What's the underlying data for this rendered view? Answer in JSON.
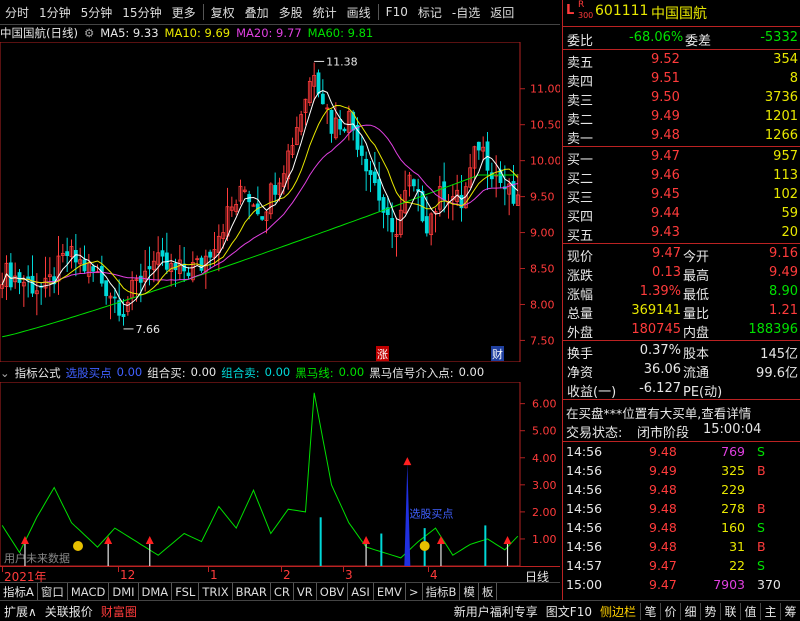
{
  "toolbar": {
    "items": [
      "分时",
      "1分钟",
      "5分钟",
      "15分钟",
      "更多",
      "复权",
      "叠加",
      "多股",
      "统计",
      "画线",
      "F10",
      "标记",
      "-自选",
      "返回"
    ]
  },
  "chart": {
    "title": "中国国航(日线)",
    "ma5": "MA5: 9.33",
    "ma10": "MA10: 9.69",
    "ma20": "MA20: 9.77",
    "ma60": "MA60: 9.81",
    "high_label": "11.38",
    "low_label": "7.66",
    "price_ticks": [
      "11.00",
      "10.50",
      "10.00",
      "9.50",
      "9.00",
      "8.50",
      "8.00",
      "7.50"
    ],
    "badge_up": "涨",
    "badge_fin": "财"
  },
  "indicator": {
    "name": "指标公式",
    "labels": [
      {
        "text": "选股买点",
        "color": "#4060ff"
      },
      {
        "text": "0.00",
        "color": "#4060ff"
      },
      {
        "text": "组合买:",
        "color": "#e6e6e6"
      },
      {
        "text": "0.00",
        "color": "#e6e6e6"
      },
      {
        "text": "组合卖:",
        "color": "#00d8d8"
      },
      {
        "text": "0.00",
        "color": "#00d8d8"
      },
      {
        "text": "黑马线:",
        "color": "#00e000"
      },
      {
        "text": "0.00",
        "color": "#00e000"
      },
      {
        "text": "黑马信号介入点:",
        "color": "#e6e6e6"
      },
      {
        "text": "0.00",
        "color": "#e6e6e6"
      }
    ],
    "ticks": [
      "6.00",
      "5.00",
      "4.00",
      "3.00",
      "2.00",
      "1.00"
    ],
    "annotation": "选股买点",
    "watermark": "用户未来数据"
  },
  "dates": [
    "2021年",
    "12",
    "1",
    "2",
    "3",
    "4"
  ],
  "axis_label": "日线",
  "tabs": [
    "指标A",
    "窗口",
    "MACD",
    "DMI",
    "DMA",
    "FSL",
    "TRIX",
    "BRAR",
    "CR",
    "VR",
    "OBV",
    "ASI",
    "EMV",
    ">",
    "指标B",
    "模",
    "板"
  ],
  "bottom": {
    "left": [
      "扩展∧",
      "关联报价",
      "财富圈"
    ],
    "middle": [
      "新用户福利专享",
      "图文F10",
      "侧边栏"
    ],
    "right": [
      "笔",
      "价",
      "细",
      "势",
      "联",
      "值",
      "主",
      "筹"
    ]
  },
  "stock": {
    "code": "601111",
    "name": "中国国航",
    "badge_l": "L",
    "badge_r": "R",
    "badge_n": "300"
  },
  "orderbook": {
    "webi_label": "委比",
    "webi_value": "-68.06%",
    "weicha_label": "委差",
    "weicha_value": "-5332",
    "asks": [
      {
        "label": "卖五",
        "price": "9.52",
        "vol": "354"
      },
      {
        "label": "卖四",
        "price": "9.51",
        "vol": "8"
      },
      {
        "label": "卖三",
        "price": "9.50",
        "vol": "3736"
      },
      {
        "label": "卖二",
        "price": "9.49",
        "vol": "1201"
      },
      {
        "label": "卖一",
        "price": "9.48",
        "vol": "1266"
      }
    ],
    "bids": [
      {
        "label": "买一",
        "price": "9.47",
        "vol": "957"
      },
      {
        "label": "买二",
        "price": "9.46",
        "vol": "113"
      },
      {
        "label": "买三",
        "price": "9.45",
        "vol": "102"
      },
      {
        "label": "买四",
        "price": "9.44",
        "vol": "59"
      },
      {
        "label": "买五",
        "price": "9.43",
        "vol": "20"
      }
    ]
  },
  "quote": [
    {
      "l": "现价",
      "v": "9.47",
      "vc": "#ff3b3b",
      "l2": "今开",
      "v2": "9.16",
      "v2c": "#ff3b3b"
    },
    {
      "l": "涨跌",
      "v": "0.13",
      "vc": "#ff3b3b",
      "l2": "最高",
      "v2": "9.49",
      "v2c": "#ff3b3b"
    },
    {
      "l": "涨幅",
      "v": "1.39%",
      "vc": "#ff3b3b",
      "l2": "最低",
      "v2": "8.90",
      "v2c": "#00e000"
    },
    {
      "l": "总量",
      "v": "369141",
      "vc": "#e8e800",
      "l2": "量比",
      "v2": "1.21",
      "v2c": "#ff3b3b"
    },
    {
      "l": "外盘",
      "v": "180745",
      "vc": "#ff3b3b",
      "l2": "内盘",
      "v2": "188396",
      "v2c": "#00e000"
    }
  ],
  "fund": [
    {
      "l": "换手",
      "v": "0.37%",
      "l2": "股本",
      "v2": "145亿"
    },
    {
      "l": "净资",
      "v": "36.06",
      "l2": "流通",
      "v2": "99.6亿"
    },
    {
      "l": "收益(一)",
      "v": "-6.127",
      "l2": "PE(动)",
      "v2": ""
    }
  ],
  "notice": "在买盘***位置有大买单,查看详情",
  "status_label": "交易状态:",
  "status_value": "闭市阶段",
  "status_time": "15:00:04",
  "trades": [
    {
      "t": "14:56",
      "p": "9.48",
      "v": "769",
      "vc": "#e040e0",
      "s": "S",
      "sc": "#00e000"
    },
    {
      "t": "14:56",
      "p": "9.49",
      "v": "325",
      "vc": "#e8e800",
      "s": "B",
      "sc": "#ff3b3b"
    },
    {
      "t": "14:56",
      "p": "9.48",
      "v": "229",
      "vc": "#e8e800",
      "s": "",
      "sc": "#e6e6e6"
    },
    {
      "t": "14:56",
      "p": "9.48",
      "v": "278",
      "vc": "#e8e800",
      "s": "B",
      "sc": "#ff3b3b"
    },
    {
      "t": "14:56",
      "p": "9.48",
      "v": "160",
      "vc": "#e8e800",
      "s": "S",
      "sc": "#00e000"
    },
    {
      "t": "14:56",
      "p": "9.48",
      "v": "31",
      "vc": "#e8e800",
      "s": "B",
      "sc": "#ff3b3b"
    },
    {
      "t": "14:57",
      "p": "9.47",
      "v": "22",
      "vc": "#e8e800",
      "s": "S",
      "sc": "#00e000"
    },
    {
      "t": "15:00",
      "p": "9.47",
      "v": "7903",
      "vc": "#e040e0",
      "s": "370",
      "sc": "#e6e6e6"
    }
  ],
  "colors": {
    "up": "#ff3b3b",
    "down": "#00d8d8",
    "ma5": "#ffffff",
    "ma10": "#e8e800",
    "ma20": "#e040e0",
    "ma60": "#00e000",
    "grid": "#b22222"
  }
}
